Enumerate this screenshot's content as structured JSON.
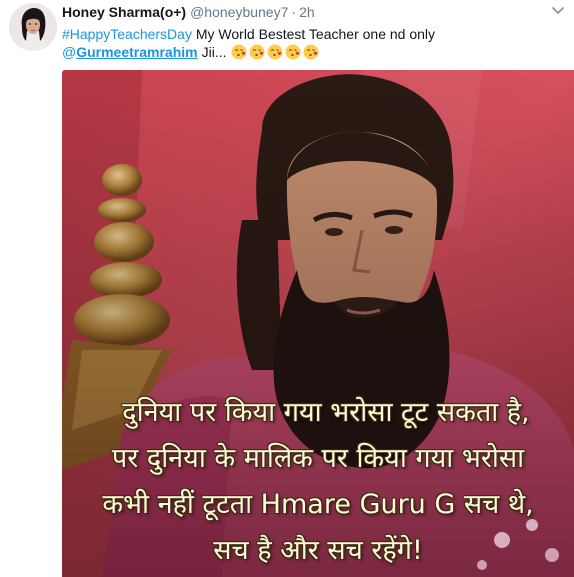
{
  "tweet": {
    "author": {
      "display_name": "Honey Sharma(o+)",
      "handle": "@honeybuney7",
      "separator": "·",
      "time": "2h",
      "avatar": "profile-photo"
    },
    "menu_icon": "chevron-down-icon",
    "text": {
      "hashtag": "#HappyTeachersDay",
      "body": " My World Bestest Teacher one nd only",
      "mention_prefix": "@",
      "mention_name": "Gurmeetramrahim",
      "suffix": "Jii...",
      "emojis": [
        "kissing-face-emoji",
        "kissing-face-emoji",
        "kissing-face-emoji",
        "kissing-face-emoji",
        "kissing-face-emoji"
      ]
    },
    "media": {
      "overlay_lines": [
        "दुनिया पर किया गया भरोसा टूट सकता है,",
        "पर दुनिया के मालिक पर किया गया भरोसा",
        "कभी नहीं टूटता Hmare Guru G सच थे,",
        "सच है और सच रहेंगे!"
      ]
    }
  },
  "colors": {
    "link": "#1b95e0",
    "secondary_text": "#657786",
    "primary_text": "#14171a",
    "overlay_text": "#fff9d6"
  }
}
